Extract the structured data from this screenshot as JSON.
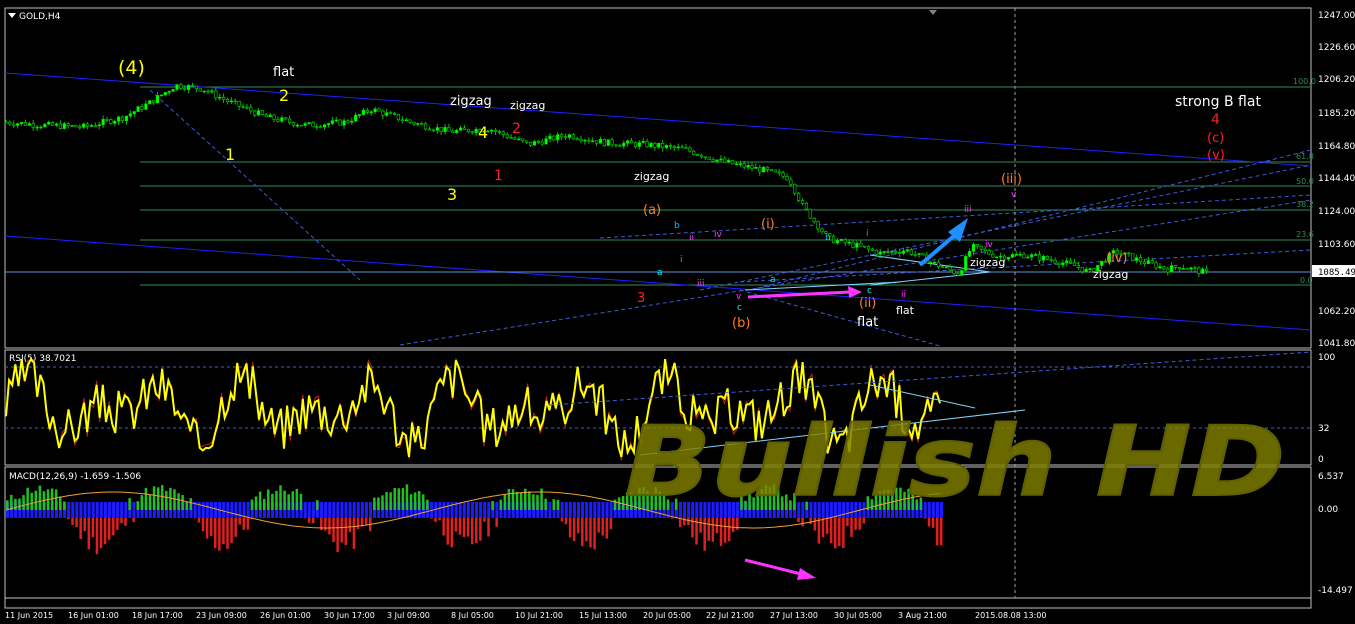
{
  "window": {
    "symbol": "GOLD,H4"
  },
  "price_scale": [
    "1247.00",
    "1226.60",
    "1206.20",
    "1185.20",
    "1164.80",
    "1144.40",
    "1124.00",
    "1103.60",
    "1082.60",
    "1062.20",
    "1041.80"
  ],
  "current_price": "1085.49",
  "fib_levels": [
    "100.0",
    "61.8",
    "50.0",
    "38.2",
    "23.6",
    "0.0"
  ],
  "rsi": {
    "label": "RSI(5) 38.7021",
    "scale": [
      "100",
      "32",
      "0"
    ]
  },
  "macd": {
    "label": "MACD(12,26,9) -1.659 -1.506",
    "scale": [
      "6.537",
      "0.00",
      "-14.497"
    ]
  },
  "time_axis": [
    "11 Jun 2015",
    "16 Jun 01:00",
    "18 Jun 17:00",
    "23 Jun 09:00",
    "26 Jun 01:00",
    "30 Jun 17:00",
    "3 Jul 09:00",
    "8 Jul 05:00",
    "10 Jul 21:00",
    "15 Jul 13:00",
    "20 Jul 05:00",
    "22 Jul 21:00",
    "27 Jul 13:00",
    "30 Jul 05:00",
    "3 Aug 21:00",
    "2015.08.08 13:00"
  ],
  "watermark": "Bullish HD",
  "labels": {
    "w4_big": "(4)",
    "flat1": "flat",
    "two_y": "2",
    "one_y": "1",
    "three_y": "3",
    "four_y": "4",
    "zigzag1": "zigzag",
    "zigzag2": "zigzag",
    "two_r": "2",
    "one_r": "1",
    "zigzag3": "zigzag",
    "a_paren": "(a)",
    "three_r": "3",
    "b_paren": "(b)",
    "c_small": "c",
    "v_small": "v",
    "ii_paren": "(ii)",
    "flat2": "flat",
    "flat3": "flat",
    "i_mag": "i",
    "ii_mag": "ii",
    "iii_mag": "iii",
    "iv_mag": "iv",
    "v_mag": "v",
    "i_orange": "(i)",
    "iii_orange": "(iii)",
    "iv_orange": "(iv)",
    "zigzag4": "zigzag",
    "zigzag5": "zigzag",
    "strong_b_flat": "strong B flat",
    "four_r": "4",
    "c_paren": "(c)",
    "v_paren": "(v)",
    "b_blue": "b",
    "a_cyan": "a",
    "b_blue2": "b",
    "a_cyan2": "a",
    "c_cyan": "c",
    "i_small": "i",
    "ii_small": "ii",
    "iii_small": "iii",
    "iv_small": "iv",
    "ii_purple": "ii"
  },
  "chart_data": {
    "type": "candlestick",
    "symbol": "GOLD",
    "timeframe": "H4",
    "ylim": [
      1041.8,
      1247.0
    ],
    "close_path": [
      [
        0,
        1180
      ],
      [
        0.03,
        1178
      ],
      [
        0.06,
        1177
      ],
      [
        0.09,
        1183
      ],
      [
        0.11,
        1192
      ],
      [
        0.13,
        1203
      ],
      [
        0.15,
        1201
      ],
      [
        0.17,
        1193
      ],
      [
        0.2,
        1183
      ],
      [
        0.23,
        1178
      ],
      [
        0.26,
        1180
      ],
      [
        0.28,
        1188
      ],
      [
        0.31,
        1180
      ],
      [
        0.34,
        1174
      ],
      [
        0.37,
        1176
      ],
      [
        0.4,
        1166
      ],
      [
        0.43,
        1172
      ],
      [
        0.46,
        1167
      ],
      [
        0.49,
        1166
      ],
      [
        0.52,
        1163
      ],
      [
        0.55,
        1155
      ],
      [
        0.58,
        1150
      ],
      [
        0.6,
        1145
      ],
      [
        0.61,
        1128
      ],
      [
        0.63,
        1107
      ],
      [
        0.65,
        1103
      ],
      [
        0.67,
        1098
      ],
      [
        0.69,
        1100
      ],
      [
        0.71,
        1092
      ],
      [
        0.73,
        1085
      ],
      [
        0.74,
        1102
      ],
      [
        0.76,
        1096
      ],
      [
        0.78,
        1097
      ],
      [
        0.8,
        1094
      ],
      [
        0.82,
        1090
      ],
      [
        0.83,
        1086
      ],
      [
        0.85,
        1099
      ],
      [
        0.87,
        1093
      ],
      [
        0.89,
        1088
      ],
      [
        0.9,
        1090
      ],
      [
        0.92,
        1085.49
      ]
    ],
    "rsi_value": 38.7021,
    "macd": {
      "main": -1.659,
      "signal": -1.506
    }
  }
}
